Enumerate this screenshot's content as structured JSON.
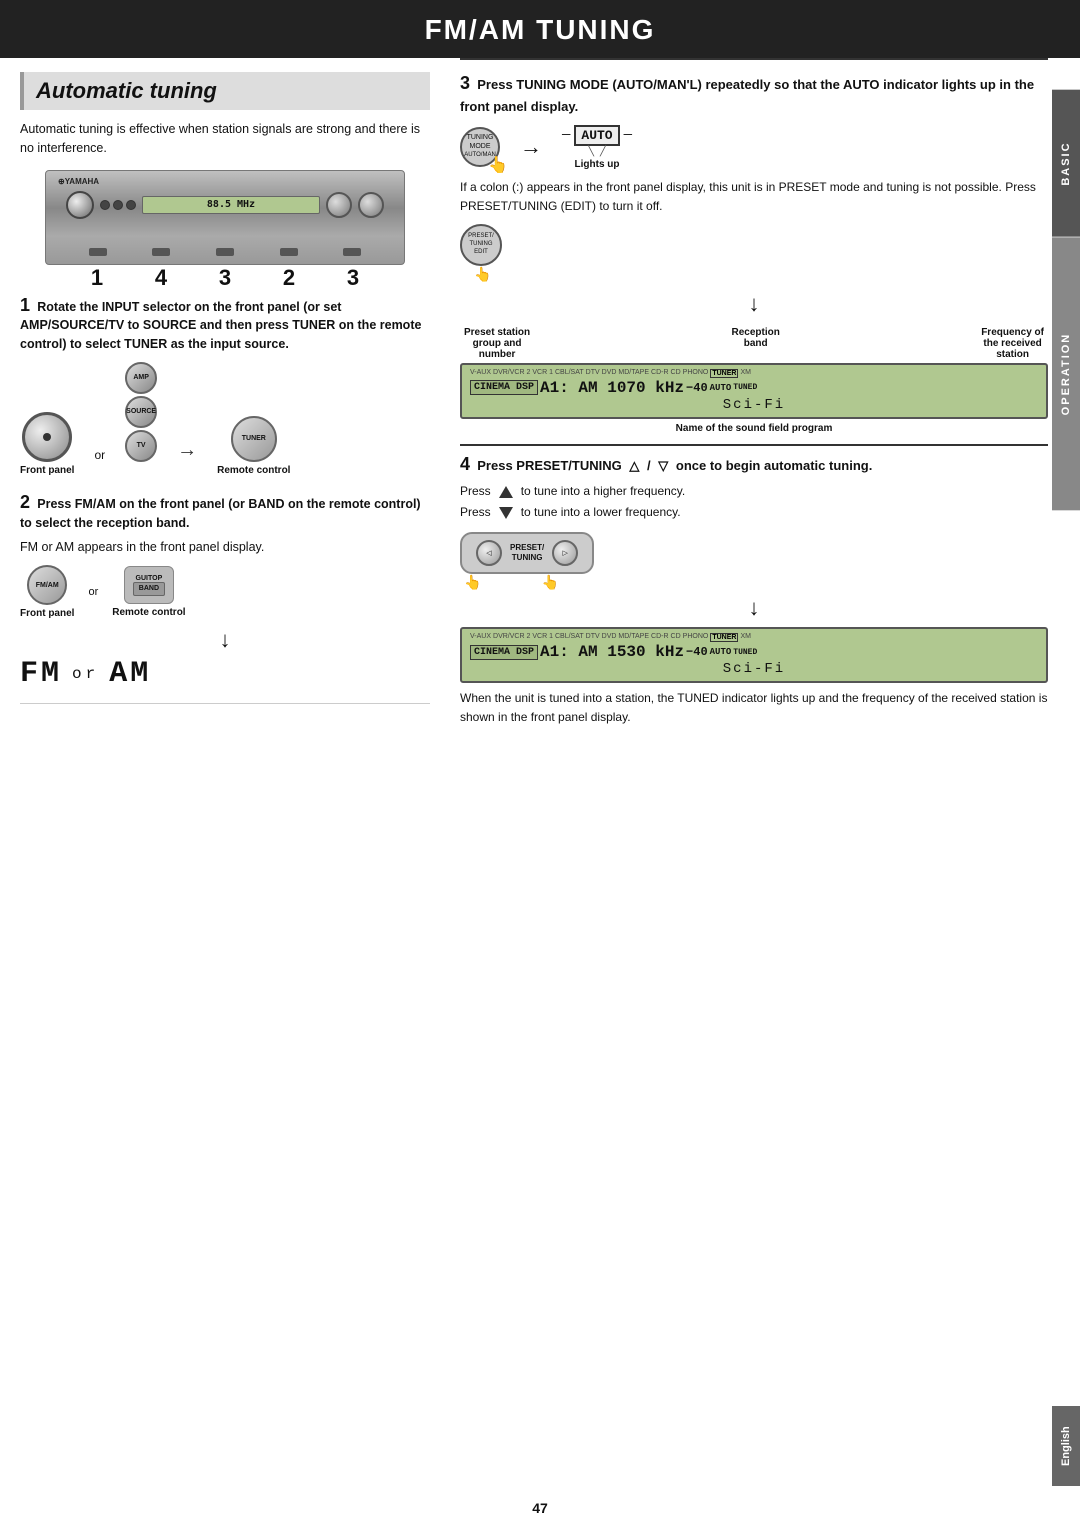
{
  "page": {
    "title": "FM/AM TUNING",
    "page_number": "47",
    "section": "Automatic tuning"
  },
  "sidebar": {
    "basic_label": "BASIC",
    "operation_label": "OPERATION",
    "english_label": "English"
  },
  "intro": {
    "text": "Automatic tuning is effective when station signals are strong and there is no interference."
  },
  "receiver_numbers": "1  4 3 2 3",
  "step1": {
    "number": "1",
    "title": "Rotate the INPUT selector on the front panel (or set AMP/SOURCE/TV to SOURCE and then press TUNER on the remote control) to select TUNER as the input source.",
    "front_panel_label": "Front panel",
    "or_label": "or",
    "remote_label": "Remote control",
    "input_label": "INPUT",
    "amp_label": "AMP",
    "source_label": "SOURCE",
    "tv_label": "TV",
    "tuner_label": "TUNER"
  },
  "step2": {
    "number": "2",
    "title": "Press FM/AM on the front panel (or BAND on the remote control) to select the reception band.",
    "body": "FM or AM appears in the front panel display.",
    "front_panel_label": "Front panel",
    "or_label": "or",
    "remote_label": "Remote control",
    "fmam_label": "FM/AM",
    "band_label": "BAND",
    "fm_label": "FM",
    "am_label": "AM",
    "or_lower": "or"
  },
  "step3": {
    "number": "3",
    "title": "Press TUNING MODE (AUTO/MAN'L) repeatedly so that the AUTO indicator lights up in the front panel display.",
    "auto_label": "AUTO",
    "lights_up_label": "Lights up",
    "desc1": "If a colon (:) appears in the front panel display, this unit is in PRESET mode and tuning is not possible. Press PRESET/TUNING (EDIT) to turn it off.",
    "preset_edit_label": "PRESET/\nTUNING\nEDIT",
    "col_labels": {
      "preset_station": "Preset station",
      "group_and": "group and",
      "number": "number",
      "reception": "Reception",
      "band": "band",
      "frequency_of": "Frequency of",
      "received": "the received",
      "station": "station"
    },
    "display1": {
      "labels": [
        "V-AUX",
        "DVR/VCR 2",
        "VCR 1",
        "CBL/SAT",
        "DTV",
        "DVD",
        "MD/TAPE",
        "CD-R",
        "CD",
        "PHONO",
        "TUNER",
        "XM"
      ],
      "main": "A1:AM 1070 kHz  -40",
      "main_display": "A1:AM|1070 kHz",
      "sub": "Sci-Fi",
      "auto_indicator": "AUTO",
      "tuned_label": "TUNED"
    },
    "sound_field_label": "Name of the sound field program"
  },
  "step4": {
    "number": "4",
    "title_start": "Press PRESET/TUNING",
    "title_slash": "/",
    "title_end": "once to begin automatic tuning.",
    "press_up": "to tune into a higher frequency.",
    "press_down": "to tune into a lower frequency.",
    "display2": {
      "labels": [
        "V-AUX",
        "DVR/VCR 2",
        "VCR 1",
        "CBL/SAT",
        "DTV",
        "DVD",
        "MD/TAPE",
        "CD-R",
        "CD",
        "PHONO",
        "TUNER",
        "XM"
      ],
      "main": "A1:AM 1530 kHz  -40",
      "sub": "Sci-Fi",
      "auto_indicator": "AUTO",
      "tuned_label": "TUNED"
    },
    "tuned_desc": "When the unit is tuned into a station, the TUNED indicator lights up and the frequency of the received station is shown in the front panel display."
  }
}
